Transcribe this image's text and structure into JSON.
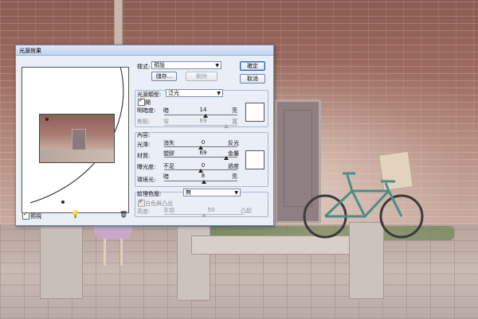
{
  "dialog": {
    "title": "光源效果",
    "style_label": "樣式:",
    "style_value": "預設",
    "save_label": "儲存...",
    "delete_label": "刪除",
    "ok_label": "確定",
    "cancel_label": "取消",
    "light_type_label": "光源類型:",
    "light_type_value": "泛光",
    "on_label": "開",
    "intensity_label": "明暗度:",
    "intensity_left": "暗",
    "intensity_value": "14",
    "intensity_right": "亮",
    "focus_label": "焦點:",
    "focus_left": "窄",
    "focus_value": "69",
    "focus_right": "寬",
    "properties_label": "內容:",
    "gloss_label": "光澤:",
    "gloss_left": "消失",
    "gloss_value": "0",
    "gloss_right": "反光",
    "material_label": "材質:",
    "material_left": "塑膠",
    "material_value": "69",
    "material_right": "金屬",
    "exposure_label": "曝光度:",
    "exposure_left": "不足",
    "exposure_value": "0",
    "exposure_right": "過度",
    "ambience_label": "環境光:",
    "ambience_left": "暗",
    "ambience_value": "8",
    "ambience_right": "亮",
    "texture_channel_label": "紋理色版:",
    "texture_channel_value": "無",
    "white_high_label": "白色與凸出",
    "height_label": "高度:",
    "height_left": "平坦",
    "height_value": "50",
    "height_right": "凸起",
    "preview_label": "預視"
  },
  "colors": {
    "dialog_bg": "#eaeff7",
    "accent": "#2f5fa5"
  },
  "icons": {
    "light_bulb": "light-bulb-icon",
    "trash": "trash-icon"
  }
}
